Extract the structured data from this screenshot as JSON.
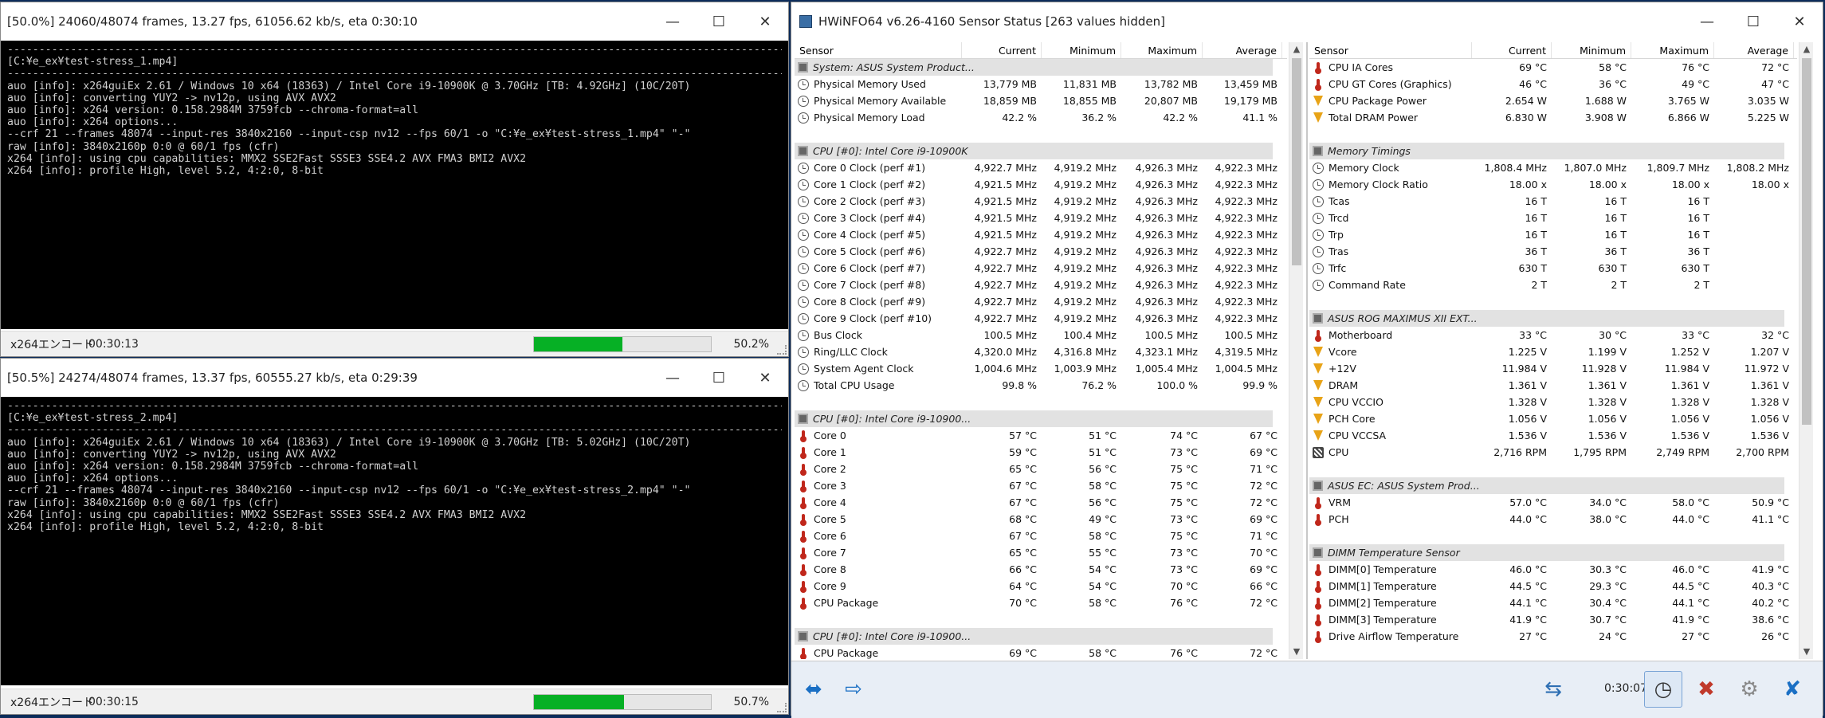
{
  "console1": {
    "title": "[50.0%] 24060/48074 frames, 13.27 fps, 61056.62 kb/s, eta 0:30:10",
    "lines": [
      "[C:¥e_ex¥test-stress_1.mp4]",
      "",
      "auo [info]: x264guiEx 2.61 / Windows 10 x64 (18363) / Intel Core i9-10900K @ 3.70GHz [TB: 4.92GHz] (10C/20T)",
      "auo [info]: converting YUY2 -> nv12p, using AVX AVX2",
      "auo [info]: x264 version: 0.158.2984M 3759fcb --chroma-format=all",
      "auo [info]: x264 options...",
      "--crf 21 --frames 48074 --input-res 3840x2160 --input-csp nv12 --fps 60/1 -o \"C:¥e_ex¥test-stress_1.mp4\" \"-\"",
      "raw [info]: 3840x2160p 0:0 @ 60/1 fps (cfr)",
      "x264 [info]: using cpu capabilities: MMX2 SSE2Fast SSSE3 SSE4.2 AVX FMA3 BMI2 AVX2",
      "x264 [info]: profile High, level 5.2, 4:2:0, 8-bit"
    ],
    "status_label": "x264エンコード",
    "elapsed": "00:30:13",
    "percent_text": "50.2%",
    "progress": 0.502
  },
  "console2": {
    "title": "[50.5%] 24274/48074 frames, 13.37 fps, 60555.27 kb/s, eta 0:29:39",
    "lines": [
      "[C:¥e_ex¥test-stress_2.mp4]",
      "",
      "auo [info]: x264guiEx 2.61 / Windows 10 x64 (18363) / Intel Core i9-10900K @ 3.70GHz [TB: 5.02GHz] (10C/20T)",
      "auo [info]: converting YUY2 -> nv12p, using AVX AVX2",
      "auo [info]: x264 version: 0.158.2984M 3759fcb --chroma-format=all",
      "auo [info]: x264 options...",
      "--crf 21 --frames 48074 --input-res 3840x2160 --input-csp nv12 --fps 60/1 -o \"C:¥e_ex¥test-stress_2.mp4\" \"-\"",
      "raw [info]: 3840x2160p 0:0 @ 60/1 fps (cfr)",
      "x264 [info]: using cpu capabilities: MMX2 SSE2Fast SSSE3 SSE4.2 AVX FMA3 BMI2 AVX2",
      "x264 [info]: profile High, level 5.2, 4:2:0, 8-bit"
    ],
    "status_label": "x264エンコード",
    "elapsed": "00:30:15",
    "percent_text": "50.7%",
    "progress": 0.507
  },
  "hwinfo": {
    "title": "HWiNFO64 v6.26-4160 Sensor Status [263 values hidden]",
    "columns": [
      "Sensor",
      "Current",
      "Minimum",
      "Maximum",
      "Average"
    ],
    "timer": "0:30:07",
    "left": [
      {
        "g": 1,
        "icon": "chip",
        "name": "System: ASUS System Product..."
      },
      {
        "icon": "clock",
        "name": "Physical Memory Used",
        "v": [
          "13,779 MB",
          "11,831 MB",
          "13,782 MB",
          "13,459 MB"
        ]
      },
      {
        "icon": "clock",
        "name": "Physical Memory Available",
        "v": [
          "18,859 MB",
          "18,855 MB",
          "20,807 MB",
          "19,179 MB"
        ]
      },
      {
        "icon": "clock",
        "name": "Physical Memory Load",
        "v": [
          "42.2 %",
          "36.2 %",
          "42.2 %",
          "41.1 %"
        ]
      },
      {
        "blank": 1
      },
      {
        "g": 1,
        "icon": "chip",
        "name": "CPU [#0]: Intel Core i9-10900K"
      },
      {
        "icon": "clock",
        "name": "Core 0 Clock (perf #1)",
        "v": [
          "4,922.7 MHz",
          "4,919.2 MHz",
          "4,926.3 MHz",
          "4,922.3 MHz"
        ]
      },
      {
        "icon": "clock",
        "name": "Core 1 Clock (perf #2)",
        "v": [
          "4,921.5 MHz",
          "4,919.2 MHz",
          "4,926.3 MHz",
          "4,922.3 MHz"
        ]
      },
      {
        "icon": "clock",
        "name": "Core 2 Clock (perf #3)",
        "v": [
          "4,921.5 MHz",
          "4,919.2 MHz",
          "4,926.3 MHz",
          "4,922.3 MHz"
        ]
      },
      {
        "icon": "clock",
        "name": "Core 3 Clock (perf #4)",
        "v": [
          "4,921.5 MHz",
          "4,919.2 MHz",
          "4,926.3 MHz",
          "4,922.3 MHz"
        ]
      },
      {
        "icon": "clock",
        "name": "Core 4 Clock (perf #5)",
        "v": [
          "4,921.5 MHz",
          "4,919.2 MHz",
          "4,926.3 MHz",
          "4,922.3 MHz"
        ]
      },
      {
        "icon": "clock",
        "name": "Core 5 Clock (perf #6)",
        "v": [
          "4,922.7 MHz",
          "4,919.2 MHz",
          "4,926.3 MHz",
          "4,922.3 MHz"
        ]
      },
      {
        "icon": "clock",
        "name": "Core 6 Clock (perf #7)",
        "v": [
          "4,922.7 MHz",
          "4,919.2 MHz",
          "4,926.3 MHz",
          "4,922.3 MHz"
        ]
      },
      {
        "icon": "clock",
        "name": "Core 7 Clock (perf #8)",
        "v": [
          "4,922.7 MHz",
          "4,919.2 MHz",
          "4,926.3 MHz",
          "4,922.3 MHz"
        ]
      },
      {
        "icon": "clock",
        "name": "Core 8 Clock (perf #9)",
        "v": [
          "4,922.7 MHz",
          "4,919.2 MHz",
          "4,926.3 MHz",
          "4,922.3 MHz"
        ]
      },
      {
        "icon": "clock",
        "name": "Core 9 Clock (perf #10)",
        "v": [
          "4,922.7 MHz",
          "4,919.2 MHz",
          "4,926.3 MHz",
          "4,922.3 MHz"
        ]
      },
      {
        "icon": "clock",
        "name": "Bus Clock",
        "v": [
          "100.5 MHz",
          "100.4 MHz",
          "100.5 MHz",
          "100.5 MHz"
        ]
      },
      {
        "icon": "clock",
        "name": "Ring/LLC Clock",
        "v": [
          "4,320.0 MHz",
          "4,316.8 MHz",
          "4,323.1 MHz",
          "4,319.5 MHz"
        ]
      },
      {
        "icon": "clock",
        "name": "System Agent Clock",
        "v": [
          "1,004.6 MHz",
          "1,003.9 MHz",
          "1,005.4 MHz",
          "1,004.5 MHz"
        ]
      },
      {
        "icon": "clock",
        "name": "Total CPU Usage",
        "v": [
          "99.8 %",
          "76.2 %",
          "100.0 %",
          "99.9 %"
        ]
      },
      {
        "blank": 1
      },
      {
        "g": 1,
        "icon": "chip",
        "name": "CPU [#0]: Intel Core i9-10900..."
      },
      {
        "icon": "therm",
        "name": "Core 0",
        "v": [
          "57 °C",
          "51 °C",
          "74 °C",
          "67 °C"
        ]
      },
      {
        "icon": "therm",
        "name": "Core 1",
        "v": [
          "59 °C",
          "51 °C",
          "73 °C",
          "69 °C"
        ]
      },
      {
        "icon": "therm",
        "name": "Core 2",
        "v": [
          "65 °C",
          "56 °C",
          "75 °C",
          "71 °C"
        ]
      },
      {
        "icon": "therm",
        "name": "Core 3",
        "v": [
          "67 °C",
          "58 °C",
          "75 °C",
          "72 °C"
        ]
      },
      {
        "icon": "therm",
        "name": "Core 4",
        "v": [
          "67 °C",
          "56 °C",
          "75 °C",
          "72 °C"
        ]
      },
      {
        "icon": "therm",
        "name": "Core 5",
        "v": [
          "68 °C",
          "49 °C",
          "73 °C",
          "69 °C"
        ]
      },
      {
        "icon": "therm",
        "name": "Core 6",
        "v": [
          "67 °C",
          "58 °C",
          "75 °C",
          "71 °C"
        ]
      },
      {
        "icon": "therm",
        "name": "Core 7",
        "v": [
          "65 °C",
          "55 °C",
          "73 °C",
          "70 °C"
        ]
      },
      {
        "icon": "therm",
        "name": "Core 8",
        "v": [
          "66 °C",
          "54 °C",
          "73 °C",
          "69 °C"
        ]
      },
      {
        "icon": "therm",
        "name": "Core 9",
        "v": [
          "64 °C",
          "54 °C",
          "70 °C",
          "66 °C"
        ]
      },
      {
        "icon": "therm",
        "name": "CPU Package",
        "v": [
          "70 °C",
          "58 °C",
          "76 °C",
          "72 °C"
        ]
      },
      {
        "blank": 1
      },
      {
        "g": 1,
        "icon": "chip",
        "name": "CPU [#0]: Intel Core i9-10900..."
      },
      {
        "icon": "therm",
        "name": "CPU Package",
        "v": [
          "69 °C",
          "58 °C",
          "76 °C",
          "72 °C"
        ]
      }
    ],
    "right": [
      {
        "icon": "therm",
        "name": "CPU IA Cores",
        "v": [
          "69 °C",
          "58 °C",
          "76 °C",
          "72 °C"
        ]
      },
      {
        "icon": "therm",
        "name": "CPU GT Cores (Graphics)",
        "v": [
          "46 °C",
          "36 °C",
          "49 °C",
          "47 °C"
        ]
      },
      {
        "icon": "volt",
        "name": "CPU Package Power",
        "v": [
          "2.654 W",
          "1.688 W",
          "3.765 W",
          "3.035 W"
        ]
      },
      {
        "icon": "volt",
        "name": "Total DRAM Power",
        "v": [
          "6.830 W",
          "3.908 W",
          "6.866 W",
          "5.225 W"
        ]
      },
      {
        "blank": 1
      },
      {
        "g": 1,
        "icon": "chip",
        "name": "Memory Timings"
      },
      {
        "icon": "clock",
        "name": "Memory Clock",
        "v": [
          "1,808.4 MHz",
          "1,807.0 MHz",
          "1,809.7 MHz",
          "1,808.2 MHz"
        ]
      },
      {
        "icon": "clock",
        "name": "Memory Clock Ratio",
        "v": [
          "18.00 x",
          "18.00 x",
          "18.00 x",
          "18.00 x"
        ]
      },
      {
        "icon": "clock",
        "name": "Tcas",
        "v": [
          "16 T",
          "16 T",
          "16 T",
          ""
        ]
      },
      {
        "icon": "clock",
        "name": "Trcd",
        "v": [
          "16 T",
          "16 T",
          "16 T",
          ""
        ]
      },
      {
        "icon": "clock",
        "name": "Trp",
        "v": [
          "16 T",
          "16 T",
          "16 T",
          ""
        ]
      },
      {
        "icon": "clock",
        "name": "Tras",
        "v": [
          "36 T",
          "36 T",
          "36 T",
          ""
        ]
      },
      {
        "icon": "clock",
        "name": "Trfc",
        "v": [
          "630 T",
          "630 T",
          "630 T",
          ""
        ]
      },
      {
        "icon": "clock",
        "name": "Command Rate",
        "v": [
          "2 T",
          "2 T",
          "2 T",
          ""
        ]
      },
      {
        "blank": 1
      },
      {
        "g": 1,
        "icon": "chip",
        "name": "ASUS ROG MAXIMUS XII EXT..."
      },
      {
        "icon": "therm",
        "name": "Motherboard",
        "v": [
          "33 °C",
          "30 °C",
          "33 °C",
          "32 °C"
        ]
      },
      {
        "icon": "volt",
        "name": "Vcore",
        "v": [
          "1.225 V",
          "1.199 V",
          "1.252 V",
          "1.207 V"
        ]
      },
      {
        "icon": "volt",
        "name": "+12V",
        "v": [
          "11.984 V",
          "11.928 V",
          "11.984 V",
          "11.972 V"
        ]
      },
      {
        "icon": "volt",
        "name": "DRAM",
        "v": [
          "1.361 V",
          "1.361 V",
          "1.361 V",
          "1.361 V"
        ]
      },
      {
        "icon": "volt",
        "name": "CPU VCCIO",
        "v": [
          "1.328 V",
          "1.328 V",
          "1.328 V",
          "1.328 V"
        ]
      },
      {
        "icon": "volt",
        "name": "PCH Core",
        "v": [
          "1.056 V",
          "1.056 V",
          "1.056 V",
          "1.056 V"
        ]
      },
      {
        "icon": "volt",
        "name": "CPU VCCSA",
        "v": [
          "1.536 V",
          "1.536 V",
          "1.536 V",
          "1.536 V"
        ]
      },
      {
        "icon": "fan",
        "name": "CPU",
        "v": [
          "2,716 RPM",
          "1,795 RPM",
          "2,749 RPM",
          "2,700 RPM"
        ]
      },
      {
        "blank": 1
      },
      {
        "g": 1,
        "icon": "chip",
        "name": "ASUS EC: ASUS System Prod..."
      },
      {
        "icon": "therm",
        "name": "VRM",
        "v": [
          "57.0 °C",
          "34.0 °C",
          "58.0 °C",
          "50.9 °C"
        ]
      },
      {
        "icon": "therm",
        "name": "PCH",
        "v": [
          "44.0 °C",
          "38.0 °C",
          "44.0 °C",
          "41.1 °C"
        ]
      },
      {
        "blank": 1
      },
      {
        "g": 1,
        "icon": "chip",
        "name": "DIMM Temperature Sensor"
      },
      {
        "icon": "therm",
        "name": "DIMM[0] Temperature",
        "v": [
          "46.0 °C",
          "30.3 °C",
          "46.0 °C",
          "41.9 °C"
        ]
      },
      {
        "icon": "therm",
        "name": "DIMM[1] Temperature",
        "v": [
          "44.5 °C",
          "29.3 °C",
          "44.5 °C",
          "40.3 °C"
        ]
      },
      {
        "icon": "therm",
        "name": "DIMM[2] Temperature",
        "v": [
          "44.1 °C",
          "30.4 °C",
          "44.1 °C",
          "40.2 °C"
        ]
      },
      {
        "icon": "therm",
        "name": "DIMM[3] Temperature",
        "v": [
          "41.9 °C",
          "30.7 °C",
          "41.9 °C",
          "38.6 °C"
        ]
      },
      {
        "icon": "therm",
        "name": "Drive Airflow Temperature",
        "v": [
          "27 °C",
          "24 °C",
          "27 °C",
          "26 °C"
        ]
      }
    ]
  }
}
